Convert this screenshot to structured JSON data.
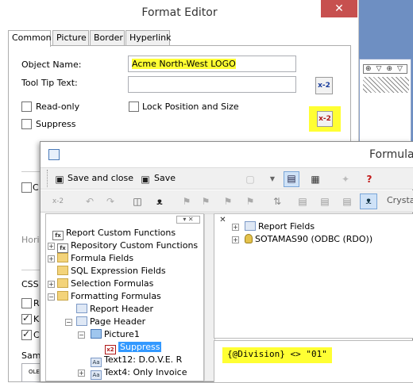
{
  "format_editor": {
    "title": "Format Editor",
    "close_glyph": "✕",
    "tabs": [
      "Common",
      "Picture",
      "Border",
      "Hyperlink"
    ],
    "object_name_label": "Object Name:",
    "object_name_value": "Acme North-West LOGO",
    "tooltip_label": "Tool Tip Text:",
    "tooltip_value": "",
    "readonly_label": "Read-only",
    "lock_label": "Lock Position and Size",
    "suppress_label": "Suppress",
    "formula_btn_glyph": "x-2",
    "partial_c": "C",
    "partial_horiz": "Horiz",
    "partial_css": "CSS C",
    "partial_r": "R",
    "partial_k": "K",
    "partial_c2": "C",
    "partial_samp": "Samp",
    "partial_ole": "OLE"
  },
  "formula_workshop": {
    "title": "Formula",
    "toolbar1": {
      "save_close": "Save and close",
      "save": "Save"
    },
    "toolbar2": {
      "crystal": "Crystal"
    },
    "left_tree": [
      {
        "label": "Report Custom Functions",
        "icon": "fx",
        "indent": 0,
        "expander": ""
      },
      {
        "label": "Repository Custom Functions",
        "icon": "fx",
        "indent": 0,
        "expander": "+"
      },
      {
        "label": "Formula Fields",
        "icon": "folder",
        "indent": 0,
        "expander": "+"
      },
      {
        "label": "SQL Expression Fields",
        "icon": "folder",
        "indent": 0,
        "expander": ""
      },
      {
        "label": "Selection Formulas",
        "icon": "folder",
        "indent": 0,
        "expander": "+"
      },
      {
        "label": "Formatting Formulas",
        "icon": "folder",
        "indent": 0,
        "expander": "−"
      },
      {
        "label": "Report Header",
        "icon": "section",
        "indent": 1,
        "expander": ""
      },
      {
        "label": "Page Header",
        "icon": "section",
        "indent": 1,
        "expander": "−"
      },
      {
        "label": "Picture1",
        "icon": "pic",
        "indent": 2,
        "expander": "−"
      },
      {
        "label": "Suppress",
        "icon": "fx",
        "indent": 3,
        "expander": "",
        "selected": true
      },
      {
        "label": "Text12: D.O.V.E. R",
        "icon": "txt",
        "indent": 2,
        "expander": ""
      },
      {
        "label": "Text4: Only Invoice",
        "icon": "txt",
        "indent": 2,
        "expander": "+"
      }
    ],
    "right_tree": [
      {
        "label": "Report Fields",
        "icon": "report"
      },
      {
        "label": "SOTAMAS90 (ODBC (RDO))",
        "icon": "db"
      }
    ],
    "formula_text": "{@Division} <> \"01\""
  },
  "colors": {
    "highlight": "#ffff33",
    "selection": "#3399ff",
    "close_button": "#c7504f"
  }
}
